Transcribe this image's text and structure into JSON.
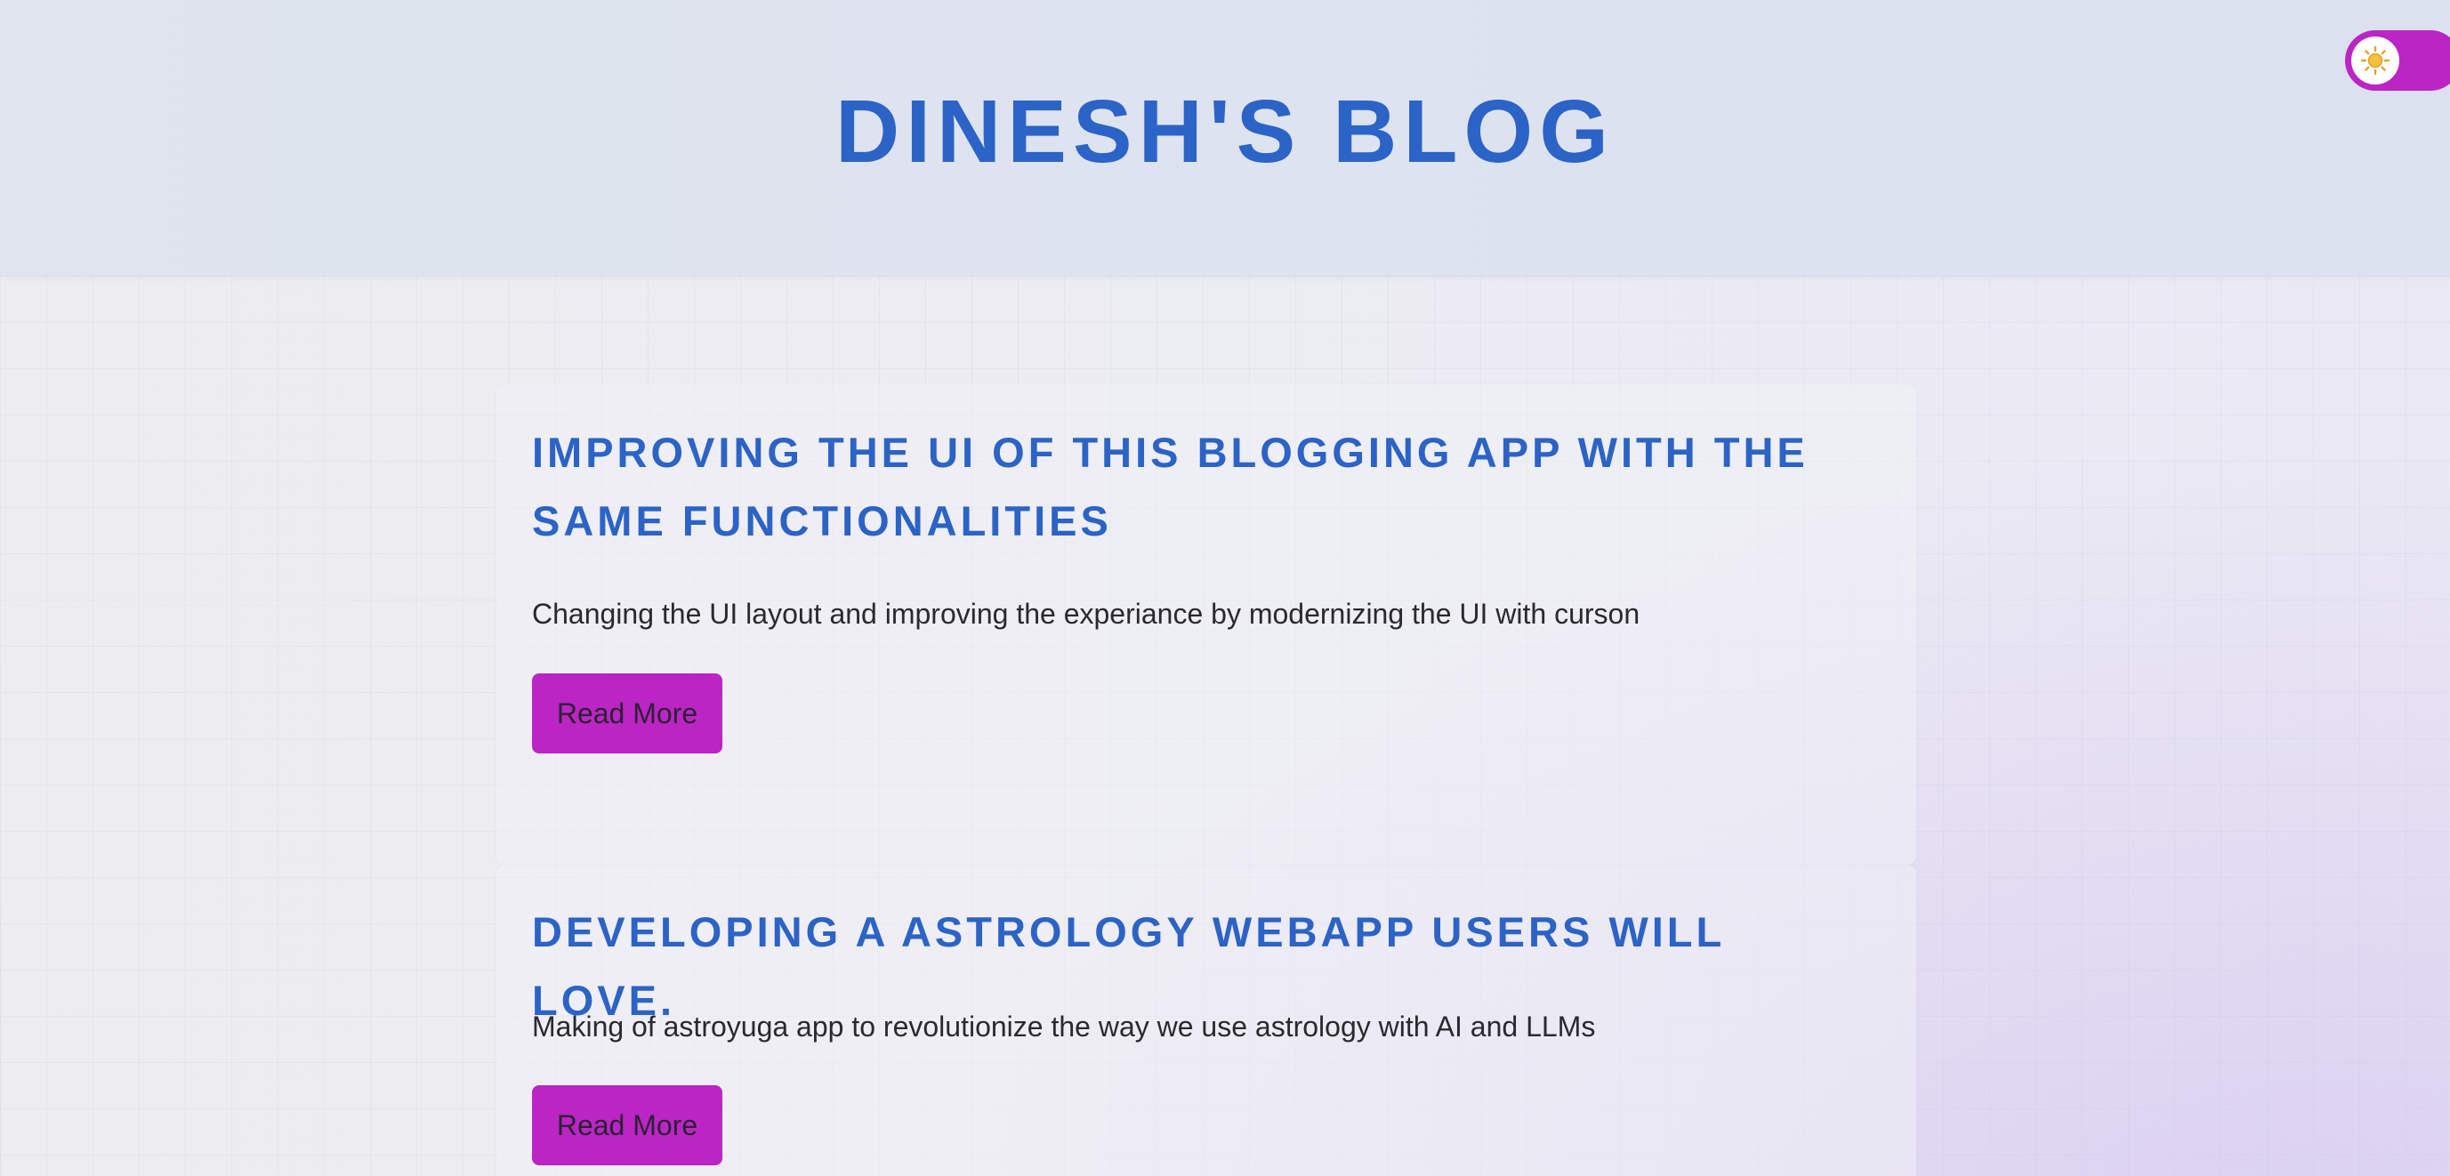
{
  "header": {
    "title": "DINESH'S BLOG"
  },
  "theme_toggle": {
    "icon": "sun-icon",
    "state": "light"
  },
  "posts": [
    {
      "title": "IMPROVING THE UI OF THIS BLOGGING APP WITH THE SAME FUNCTIONALITIES",
      "summary": "Changing the UI layout and improving the experiance by modernizing the UI with curson",
      "button_label": "Read More"
    },
    {
      "title": "DEVELOPING A ASTROLOGY WEBAPP USERS WILL LOVE.",
      "summary": "Making of astroyuga app to revolutionize the way we use astrology with AI and LLMs",
      "button_label": "Read More"
    }
  ],
  "colors": {
    "accent": "#bb25c4",
    "heading": "#2c63c6",
    "header_bg": "#dfe4ee",
    "page_bg": "#ededf0",
    "body_text": "#2a2a2e"
  }
}
